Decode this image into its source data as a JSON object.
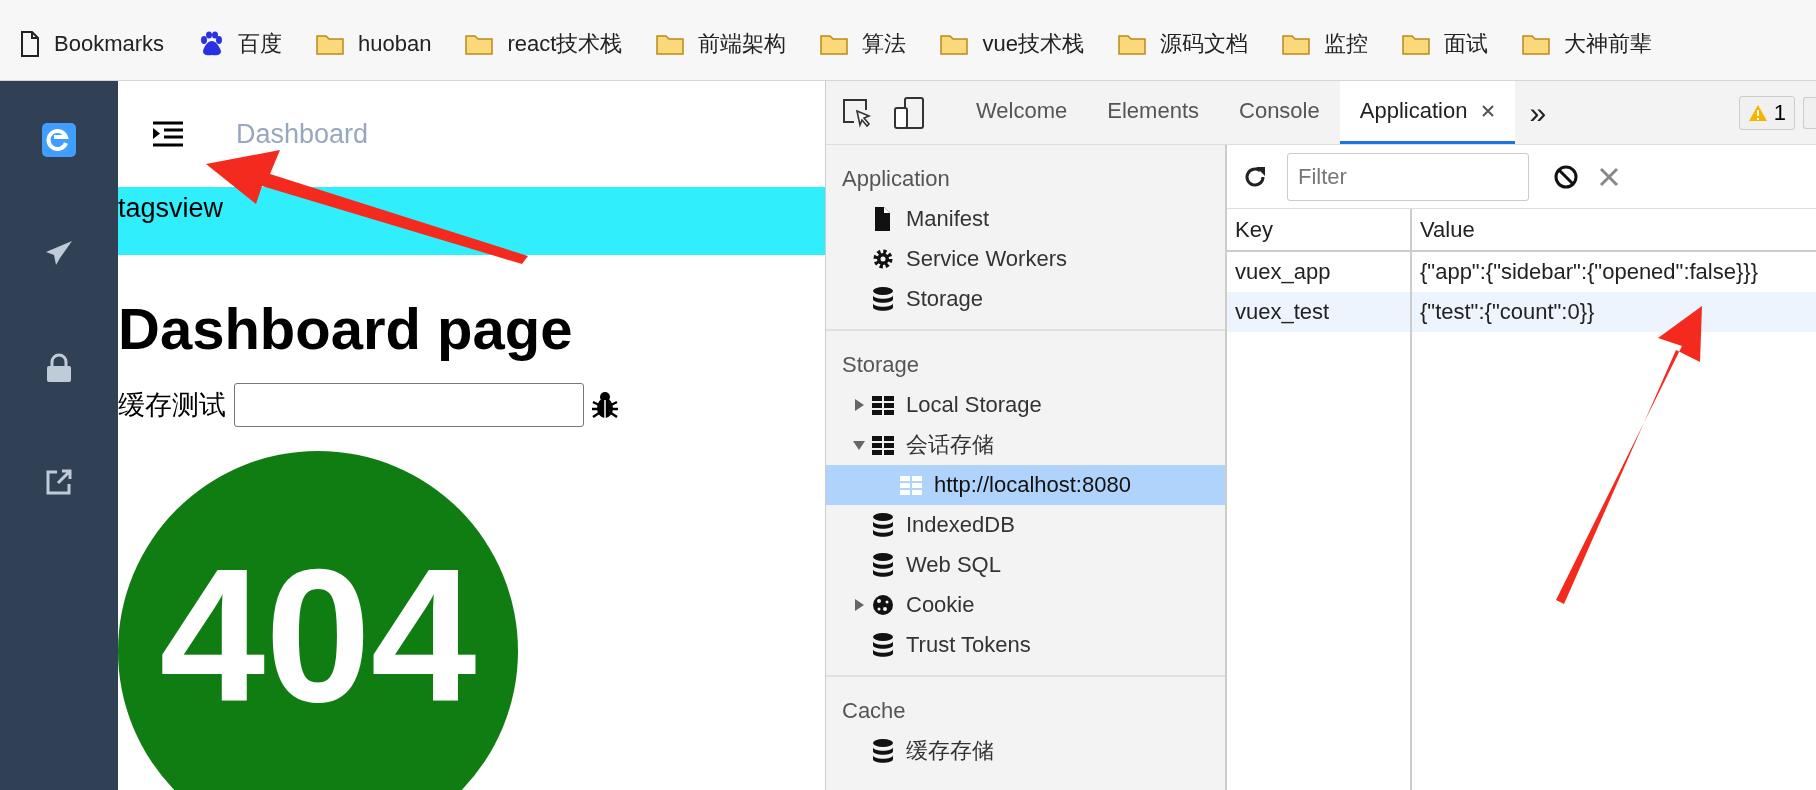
{
  "bookmarks_bar": {
    "items": [
      {
        "label": "Bookmarks",
        "kind": "page"
      },
      {
        "label": "百度",
        "kind": "baidu"
      },
      {
        "label": "huoban",
        "kind": "folder"
      },
      {
        "label": "react技术栈",
        "kind": "folder"
      },
      {
        "label": "前端架构",
        "kind": "folder"
      },
      {
        "label": "算法",
        "kind": "folder"
      },
      {
        "label": "vue技术栈",
        "kind": "folder"
      },
      {
        "label": "源码文档",
        "kind": "folder"
      },
      {
        "label": "监控",
        "kind": "folder"
      },
      {
        "label": "面试",
        "kind": "folder"
      },
      {
        "label": "大神前辈",
        "kind": "folder"
      }
    ]
  },
  "app": {
    "sidebar": {
      "items": [
        {
          "kind": "logo"
        },
        {
          "kind": "plane"
        },
        {
          "kind": "lock"
        },
        {
          "kind": "external"
        }
      ]
    },
    "navbar": {
      "breadcrumb": "Dashboard"
    },
    "tagsview": {
      "label": "tagsview"
    },
    "heading": "Dashboard page",
    "cache_test": {
      "label": "缓存测试"
    },
    "error_image": {
      "text": "404"
    }
  },
  "devtools": {
    "tabs": [
      {
        "label": "Welcome",
        "selected": false
      },
      {
        "label": "Elements",
        "selected": false
      },
      {
        "label": "Console",
        "selected": false
      },
      {
        "label": "Application",
        "selected": true
      }
    ],
    "more": "»",
    "warnings": "1",
    "sidebar": {
      "sections": [
        {
          "title": "Application",
          "items": [
            {
              "label": "Manifest",
              "kind": "file",
              "selected": false
            },
            {
              "label": "Service Workers",
              "kind": "gear",
              "selected": false
            },
            {
              "label": "Storage",
              "kind": "db",
              "selected": false
            }
          ]
        },
        {
          "title": "Storage",
          "items": [
            {
              "label": "Local Storage",
              "kind": "grid",
              "selected": false,
              "expanded": false
            },
            {
              "label": "会话存储",
              "kind": "grid",
              "selected": false,
              "expanded": true,
              "children": [
                {
                  "label": "http://localhost:8080",
                  "kind": "grid",
                  "selected": true
                }
              ]
            },
            {
              "label": "IndexedDB",
              "kind": "db",
              "selected": false
            },
            {
              "label": "Web SQL",
              "kind": "db",
              "selected": false
            },
            {
              "label": "Cookie",
              "kind": "cookie",
              "selected": false,
              "expanded": false
            },
            {
              "label": "Trust Tokens",
              "kind": "db",
              "selected": false
            }
          ]
        },
        {
          "title": "Cache",
          "items": [
            {
              "label": "缓存存储",
              "kind": "db",
              "selected": false
            }
          ]
        }
      ]
    },
    "filter": {
      "placeholder": "Filter"
    },
    "table": {
      "columns": [
        "Key",
        "Value"
      ],
      "rows": [
        {
          "key": "vuex_app",
          "value": "{\"app\":{\"sidebar\":{\"opened\":false}}}",
          "selected": false
        },
        {
          "key": "vuex_test",
          "value": "{\"test\":{\"count\":0}}",
          "selected": true
        }
      ]
    }
  }
}
